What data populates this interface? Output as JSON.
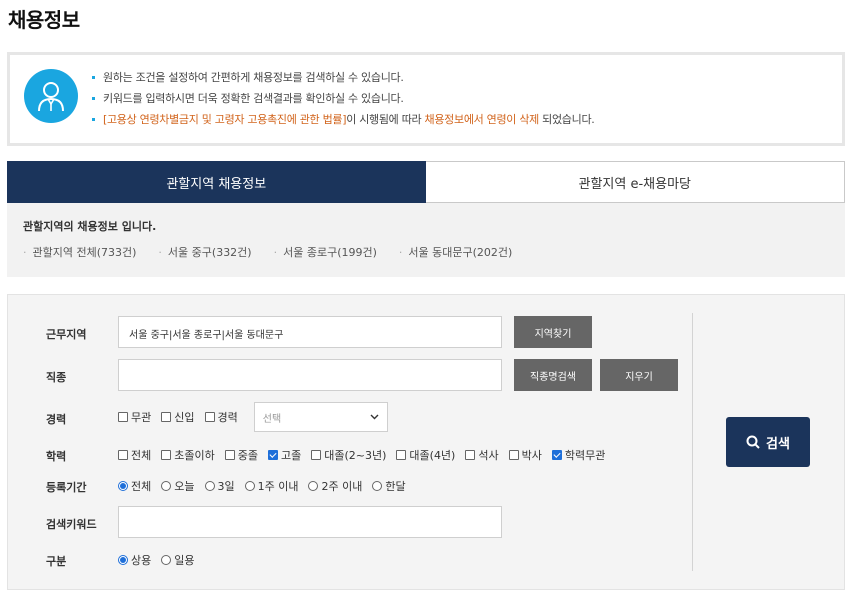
{
  "page": {
    "title": "채용정보"
  },
  "notice": {
    "line1": "원하는 조건을 설정하여 간편하게 채용정보를 검색하실 수 있습니다.",
    "line2": "키워드를 입력하시면 더욱 정확한 검색결과를 확인하실 수 있습니다.",
    "line3_highlight1": "[고용상 연령차별금지 및 고령자 고용촉진에 관한 법률]",
    "line3_mid": "이 시행됨에 따라 ",
    "line3_highlight2": "채용정보에서 연령이 삭제",
    "line3_end": " 되었습니다.",
    "icon": "person-icon"
  },
  "tabs": [
    {
      "label": "관할지역 채용정보",
      "active": true
    },
    {
      "label": "관할지역 e-채용마당",
      "active": false
    }
  ],
  "region": {
    "title": "관할지역의 채용정보 입니다.",
    "links": [
      "관할지역 전체(733건)",
      "서울 중구(332건)",
      "서울 종로구(199건)",
      "서울 동대문구(202건)"
    ]
  },
  "search": {
    "work_area": {
      "label": "근무지역",
      "value": "서울 중구|서울 종로구|서울 동대문구",
      "button": "지역찾기"
    },
    "job_type": {
      "label": "직종",
      "value": "",
      "search_button": "직종명검색",
      "clear_button": "지우기"
    },
    "career": {
      "label": "경력",
      "options": [
        {
          "label": "무관",
          "checked": false
        },
        {
          "label": "신입",
          "checked": false
        },
        {
          "label": "경력",
          "checked": false
        }
      ],
      "select_value": "선택"
    },
    "education": {
      "label": "학력",
      "options": [
        {
          "label": "전체",
          "checked": false
        },
        {
          "label": "초졸이하",
          "checked": false
        },
        {
          "label": "중졸",
          "checked": false
        },
        {
          "label": "고졸",
          "checked": true
        },
        {
          "label": "대졸(2~3년)",
          "checked": false
        },
        {
          "label": "대졸(4년)",
          "checked": false
        },
        {
          "label": "석사",
          "checked": false
        },
        {
          "label": "박사",
          "checked": false
        },
        {
          "label": "학력무관",
          "checked": true
        }
      ]
    },
    "period": {
      "label": "등록기간",
      "options": [
        {
          "label": "전체",
          "selected": true
        },
        {
          "label": "오늘",
          "selected": false
        },
        {
          "label": "3일",
          "selected": false
        },
        {
          "label": "1주 이내",
          "selected": false
        },
        {
          "label": "2주 이내",
          "selected": false
        },
        {
          "label": "한달",
          "selected": false
        }
      ]
    },
    "keyword": {
      "label": "검색키워드",
      "value": ""
    },
    "category": {
      "label": "구분",
      "options": [
        {
          "label": "상용",
          "selected": true
        },
        {
          "label": "일용",
          "selected": false
        }
      ]
    },
    "search_button": "검색",
    "accent_color": "#1b345b",
    "check_color": "#1e6fd9"
  }
}
